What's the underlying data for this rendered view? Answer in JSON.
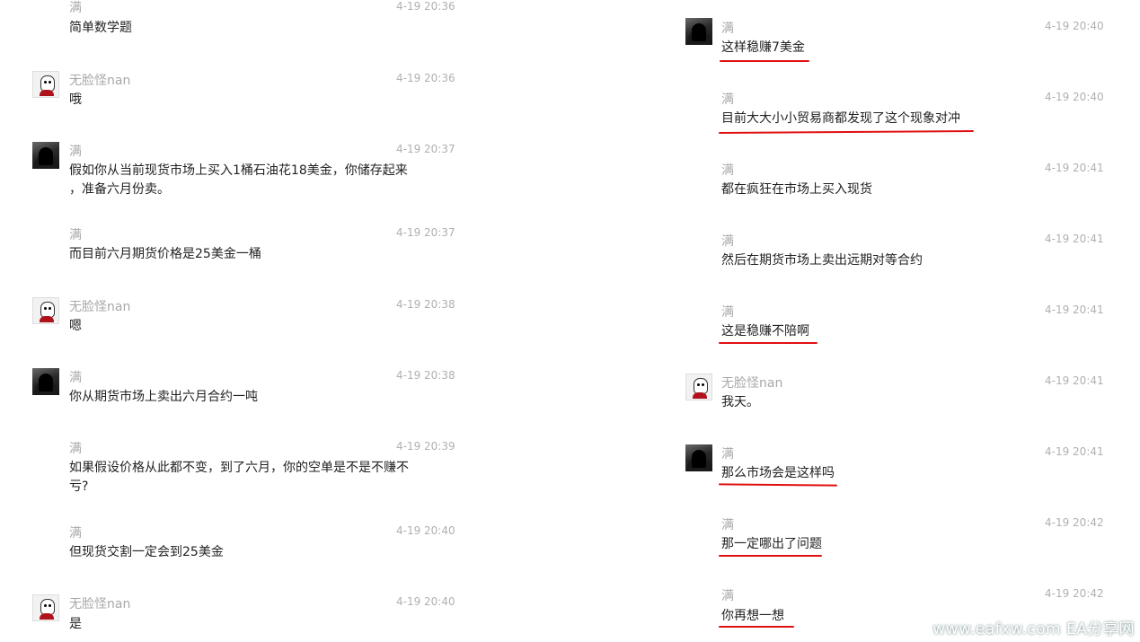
{
  "left": [
    {
      "name": "满",
      "time": "4-19 20:36",
      "text": "简单数学题"
    },
    {
      "name": "无脸怪nan",
      "time": "4-19 20:36",
      "text": "哦"
    },
    {
      "name": "满",
      "time": "4-19 20:37",
      "text": "假如你从当前现货市场上买入1桶石油花18美金，你储存起来",
      "text2": "，准备六月份卖。"
    },
    {
      "name": "满",
      "time": "4-19 20:37",
      "text": "而目前六月期货价格是25美金一桶"
    },
    {
      "name": "无脸怪nan",
      "time": "4-19 20:38",
      "text": "嗯"
    },
    {
      "name": "满",
      "time": "4-19 20:38",
      "text": "你从期货市场上卖出六月合约一吨"
    },
    {
      "name": "满",
      "time": "4-19 20:39",
      "text": "如果假设价格从此都不变，到了六月，你的空单是不是不赚不",
      "text2": "亏?"
    },
    {
      "name": "满",
      "time": "4-19 20:40",
      "text": "但现货交割一定会到25美金"
    },
    {
      "name": "无脸怪nan",
      "time": "4-19 20:40",
      "text": "是"
    }
  ],
  "right": [
    {
      "name": "满",
      "time": "4-19 20:40",
      "text": "这样稳赚7美金"
    },
    {
      "name": "满",
      "time": "4-19 20:40",
      "text": "目前大大小小贸易商都发现了这个现象对冲"
    },
    {
      "name": "满",
      "time": "4-19 20:41",
      "text": "都在疯狂在市场上买入现货"
    },
    {
      "name": "满",
      "time": "4-19 20:41",
      "text": "然后在期货市场上卖出远期对等合约"
    },
    {
      "name": "满",
      "time": "4-19 20:41",
      "text": "这是稳赚不陪啊"
    },
    {
      "name": "无脸怪nan",
      "time": "4-19 20:41",
      "text": "我天。"
    },
    {
      "name": "满",
      "time": "4-19 20:41",
      "text": "那么市场会是这样吗"
    },
    {
      "name": "满",
      "time": "4-19 20:42",
      "text": "那一定哪出了问题"
    },
    {
      "name": "满",
      "time": "4-19 20:42",
      "text": "你再想一想"
    }
  ],
  "watermark": "www.eafxw.com  EA分享网",
  "colors": {
    "annotation": "#e01010",
    "meta": "#a8a8a8"
  }
}
